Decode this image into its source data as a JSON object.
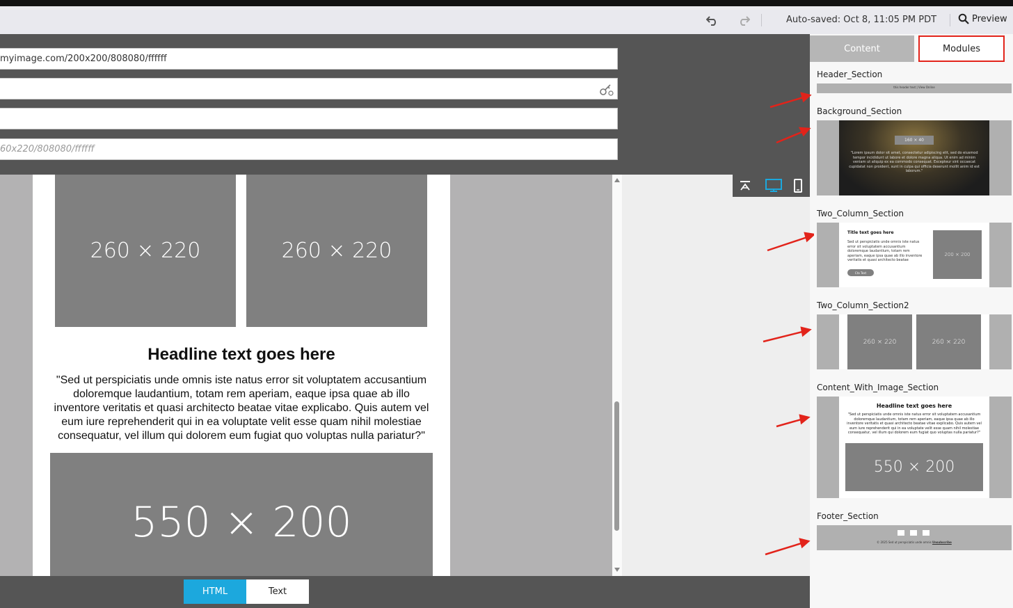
{
  "toolbar": {
    "autosave_text": "Auto-saved: Oct 8, 11:05 PM PDT",
    "preview_label": "Preview"
  },
  "fields": {
    "image_url_1": "myimage.com/200x200/808080/ffffff",
    "field_2": "",
    "field_3": "",
    "image_url_placeholder": "60x220/808080/ffffff"
  },
  "email": {
    "img_left_label": "260 × 220",
    "img_right_label": "260 × 220",
    "headline": "Headline text goes here",
    "body": "\"Sed ut perspiciatis unde omnis iste natus error sit voluptatem accusantium doloremque laudantium, totam rem aperiam, eaque ipsa quae ab illo inventore veritatis et quasi architecto beatae vitae explicabo. Quis autem vel eum iure reprehenderit qui in ea voluptate velit esse quam nihil molestiae consequatur, vel illum qui dolorem eum fugiat quo voluptas nulla pariatur?\"",
    "img_bottom_label": "550 × 200"
  },
  "bottom_tabs": {
    "html_label": "HTML",
    "text_label": "Text"
  },
  "panel": {
    "tab_content": "Content",
    "tab_modules": "Modules",
    "modules": [
      {
        "name": "Header_Section",
        "thumb_text": "this header text  |  View Online"
      },
      {
        "name": "Background_Section",
        "thumb_badge": "160 × 40",
        "thumb_text": "\"Lorem ipsum dolor sit amet, consectetur adipiscing elit, sed do eiusmod tempor incididunt ut labore et dolore magna aliqua. Ut enim ad minim veniam ut aliquip ex ea commodo consequat. Excepteur sint occaecat cupidatat non proident, sunt in culpa qui officia deserunt mollit anim id est laborum.\""
      },
      {
        "name": "Two_Column_Section",
        "thumb_title": "Title text goes here",
        "thumb_text": "Sed ut perspiciatis unde omnis iste natus error sit voluptatem accusantium doloremque laudantium, totam rem aperiam, eaque ipsa quae ab illo inventore veritatis et quasi architecto beatae",
        "thumb_button": "Cta Text",
        "thumb_img": "200 × 200"
      },
      {
        "name": "Two_Column_Section2",
        "thumb_img_left": "260 × 220",
        "thumb_img_right": "260 × 220"
      },
      {
        "name": "Content_With_Image_Section",
        "thumb_title": "Headline text goes here",
        "thumb_text": "\"Sed ut perspiciatis unde omnis iste natus error sit voluptatem accusantium doloremque laudantium, totam rem aperiam, eaque ipsa quae ab illo inventore veritatis et quasi architecto beatae vitae explicabo. Quis autem vel eum iure reprehenderit qui in ea voluptate velit esse quam nihil molestiae consequatur, vel illum qui dolorem eum fugiat quo voluptas nulla pariatur?\"",
        "thumb_img": "550 × 200"
      },
      {
        "name": "Footer_Section",
        "thumb_text": "© 2025 Sed ut perspiciatis unde omnis",
        "thumb_link": "Unsubscribe"
      }
    ]
  },
  "colors": {
    "accent_blue": "#1ca8dd",
    "highlight_red": "#e2231a",
    "placeholder_gray": "#808080"
  }
}
